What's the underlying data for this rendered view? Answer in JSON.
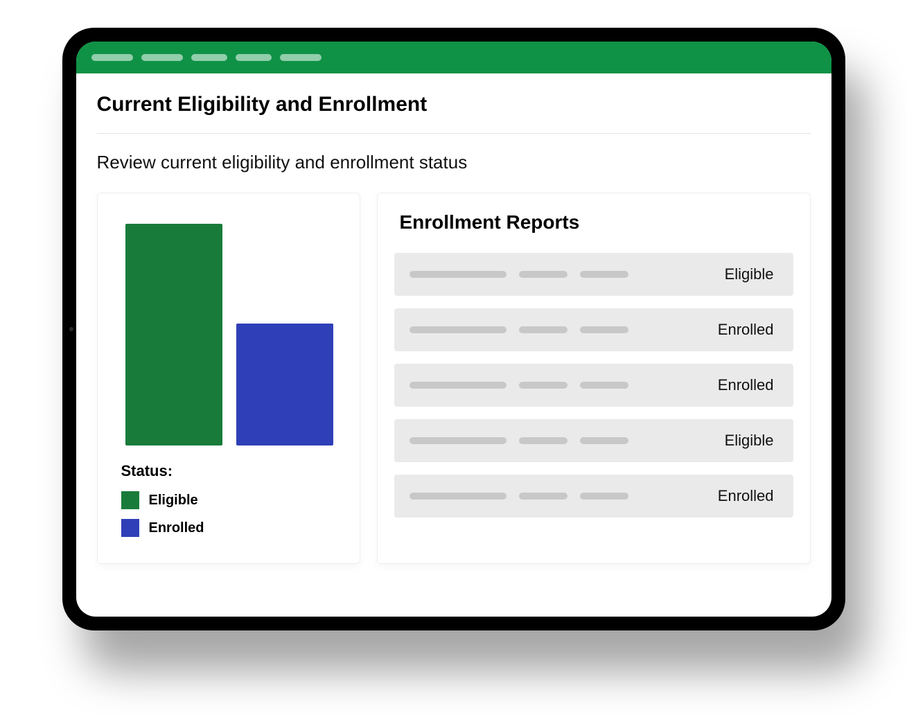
{
  "colors": {
    "accent_green": "#0f9246",
    "eligible": "#197b3a",
    "enrolled": "#2f3fb8"
  },
  "page": {
    "title": "Current Eligibility and Enrollment",
    "subtitle": "Review current eligibility and enrollment status"
  },
  "chart_data": {
    "type": "bar",
    "categories": [
      "Eligible",
      "Enrolled"
    ],
    "values": [
      100,
      55
    ],
    "title": "",
    "xlabel": "",
    "ylabel": "",
    "ylim": [
      0,
      100
    ],
    "series_colors": [
      "#197b3a",
      "#2f3fb8"
    ],
    "legend_title": "Status:",
    "legend": [
      {
        "label": "Eligible",
        "color": "#197b3a"
      },
      {
        "label": "Enrolled",
        "color": "#2f3fb8"
      }
    ]
  },
  "reports": {
    "title": "Enrollment Reports",
    "rows": [
      {
        "status": "Eligible"
      },
      {
        "status": "Enrolled"
      },
      {
        "status": "Enrolled"
      },
      {
        "status": "Eligible"
      },
      {
        "status": "Enrolled"
      }
    ]
  },
  "topbar": {
    "pill_widths": [
      60,
      60,
      52,
      52,
      60
    ]
  }
}
